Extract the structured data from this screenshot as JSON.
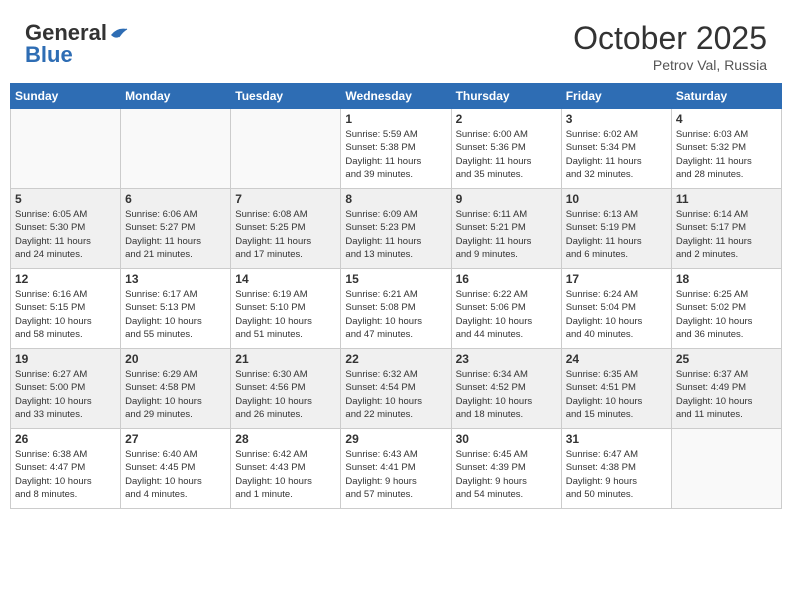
{
  "header": {
    "logo_general": "General",
    "logo_blue": "Blue",
    "month_year": "October 2025",
    "location": "Petrov Val, Russia"
  },
  "days_of_week": [
    "Sunday",
    "Monday",
    "Tuesday",
    "Wednesday",
    "Thursday",
    "Friday",
    "Saturday"
  ],
  "weeks": [
    {
      "shaded": false,
      "days": [
        {
          "num": "",
          "info": ""
        },
        {
          "num": "",
          "info": ""
        },
        {
          "num": "",
          "info": ""
        },
        {
          "num": "1",
          "info": "Sunrise: 5:59 AM\nSunset: 5:38 PM\nDaylight: 11 hours\nand 39 minutes."
        },
        {
          "num": "2",
          "info": "Sunrise: 6:00 AM\nSunset: 5:36 PM\nDaylight: 11 hours\nand 35 minutes."
        },
        {
          "num": "3",
          "info": "Sunrise: 6:02 AM\nSunset: 5:34 PM\nDaylight: 11 hours\nand 32 minutes."
        },
        {
          "num": "4",
          "info": "Sunrise: 6:03 AM\nSunset: 5:32 PM\nDaylight: 11 hours\nand 28 minutes."
        }
      ]
    },
    {
      "shaded": true,
      "days": [
        {
          "num": "5",
          "info": "Sunrise: 6:05 AM\nSunset: 5:30 PM\nDaylight: 11 hours\nand 24 minutes."
        },
        {
          "num": "6",
          "info": "Sunrise: 6:06 AM\nSunset: 5:27 PM\nDaylight: 11 hours\nand 21 minutes."
        },
        {
          "num": "7",
          "info": "Sunrise: 6:08 AM\nSunset: 5:25 PM\nDaylight: 11 hours\nand 17 minutes."
        },
        {
          "num": "8",
          "info": "Sunrise: 6:09 AM\nSunset: 5:23 PM\nDaylight: 11 hours\nand 13 minutes."
        },
        {
          "num": "9",
          "info": "Sunrise: 6:11 AM\nSunset: 5:21 PM\nDaylight: 11 hours\nand 9 minutes."
        },
        {
          "num": "10",
          "info": "Sunrise: 6:13 AM\nSunset: 5:19 PM\nDaylight: 11 hours\nand 6 minutes."
        },
        {
          "num": "11",
          "info": "Sunrise: 6:14 AM\nSunset: 5:17 PM\nDaylight: 11 hours\nand 2 minutes."
        }
      ]
    },
    {
      "shaded": false,
      "days": [
        {
          "num": "12",
          "info": "Sunrise: 6:16 AM\nSunset: 5:15 PM\nDaylight: 10 hours\nand 58 minutes."
        },
        {
          "num": "13",
          "info": "Sunrise: 6:17 AM\nSunset: 5:13 PM\nDaylight: 10 hours\nand 55 minutes."
        },
        {
          "num": "14",
          "info": "Sunrise: 6:19 AM\nSunset: 5:10 PM\nDaylight: 10 hours\nand 51 minutes."
        },
        {
          "num": "15",
          "info": "Sunrise: 6:21 AM\nSunset: 5:08 PM\nDaylight: 10 hours\nand 47 minutes."
        },
        {
          "num": "16",
          "info": "Sunrise: 6:22 AM\nSunset: 5:06 PM\nDaylight: 10 hours\nand 44 minutes."
        },
        {
          "num": "17",
          "info": "Sunrise: 6:24 AM\nSunset: 5:04 PM\nDaylight: 10 hours\nand 40 minutes."
        },
        {
          "num": "18",
          "info": "Sunrise: 6:25 AM\nSunset: 5:02 PM\nDaylight: 10 hours\nand 36 minutes."
        }
      ]
    },
    {
      "shaded": true,
      "days": [
        {
          "num": "19",
          "info": "Sunrise: 6:27 AM\nSunset: 5:00 PM\nDaylight: 10 hours\nand 33 minutes."
        },
        {
          "num": "20",
          "info": "Sunrise: 6:29 AM\nSunset: 4:58 PM\nDaylight: 10 hours\nand 29 minutes."
        },
        {
          "num": "21",
          "info": "Sunrise: 6:30 AM\nSunset: 4:56 PM\nDaylight: 10 hours\nand 26 minutes."
        },
        {
          "num": "22",
          "info": "Sunrise: 6:32 AM\nSunset: 4:54 PM\nDaylight: 10 hours\nand 22 minutes."
        },
        {
          "num": "23",
          "info": "Sunrise: 6:34 AM\nSunset: 4:52 PM\nDaylight: 10 hours\nand 18 minutes."
        },
        {
          "num": "24",
          "info": "Sunrise: 6:35 AM\nSunset: 4:51 PM\nDaylight: 10 hours\nand 15 minutes."
        },
        {
          "num": "25",
          "info": "Sunrise: 6:37 AM\nSunset: 4:49 PM\nDaylight: 10 hours\nand 11 minutes."
        }
      ]
    },
    {
      "shaded": false,
      "days": [
        {
          "num": "26",
          "info": "Sunrise: 6:38 AM\nSunset: 4:47 PM\nDaylight: 10 hours\nand 8 minutes."
        },
        {
          "num": "27",
          "info": "Sunrise: 6:40 AM\nSunset: 4:45 PM\nDaylight: 10 hours\nand 4 minutes."
        },
        {
          "num": "28",
          "info": "Sunrise: 6:42 AM\nSunset: 4:43 PM\nDaylight: 10 hours\nand 1 minute."
        },
        {
          "num": "29",
          "info": "Sunrise: 6:43 AM\nSunset: 4:41 PM\nDaylight: 9 hours\nand 57 minutes."
        },
        {
          "num": "30",
          "info": "Sunrise: 6:45 AM\nSunset: 4:39 PM\nDaylight: 9 hours\nand 54 minutes."
        },
        {
          "num": "31",
          "info": "Sunrise: 6:47 AM\nSunset: 4:38 PM\nDaylight: 9 hours\nand 50 minutes."
        },
        {
          "num": "",
          "info": ""
        }
      ]
    }
  ]
}
